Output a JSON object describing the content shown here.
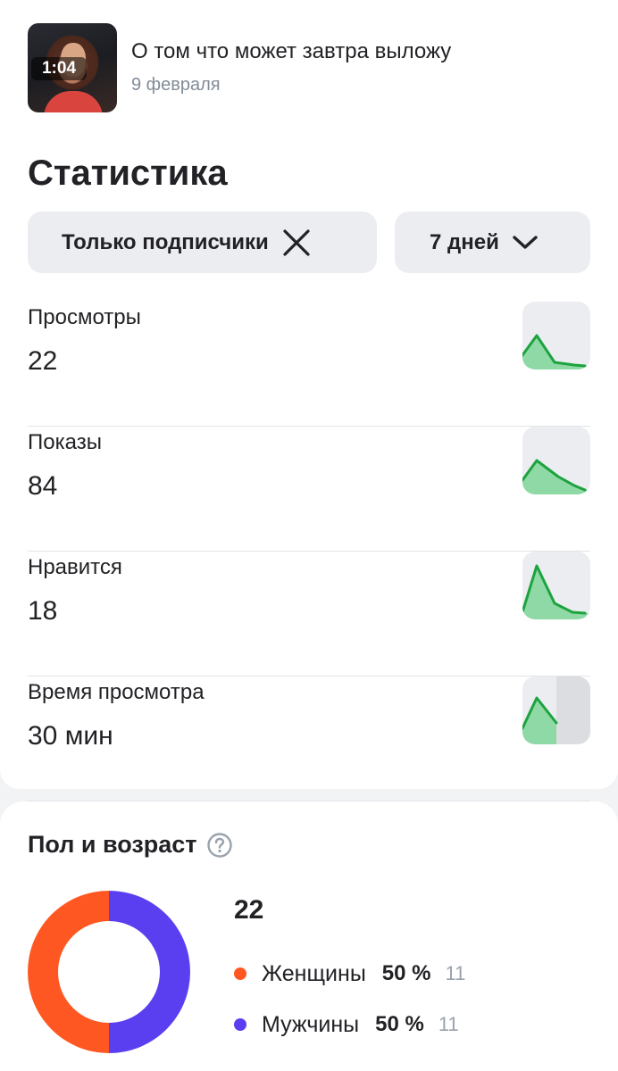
{
  "video": {
    "duration": "1:04",
    "title": "О том что может завтра выложу",
    "date": "9 февраля"
  },
  "stats": {
    "title": "Статистика",
    "filters": {
      "audience_label": "Только подписчики",
      "period_label": "7 дней"
    },
    "metrics": [
      {
        "label": "Просмотры",
        "value": "22"
      },
      {
        "label": "Показы",
        "value": "84"
      },
      {
        "label": "Нравится",
        "value": "18"
      },
      {
        "label": "Время просмотра",
        "value": "30 мин"
      }
    ]
  },
  "demographics": {
    "title": "Пол и возраст",
    "total": "22",
    "groups": [
      {
        "name": "Женщины",
        "percent": "50 %",
        "count": "11",
        "color": "#ff5722"
      },
      {
        "name": "Мужчины",
        "percent": "50 %",
        "count": "11",
        "color": "#5a3ff0"
      }
    ]
  },
  "colors": {
    "sparkline_line": "#1da33f",
    "sparkline_fill": "#8fd9a6",
    "chip_bg": "#ebedf0"
  }
}
